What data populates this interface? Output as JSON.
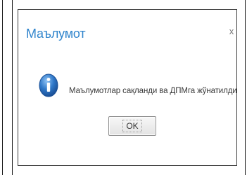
{
  "dialog": {
    "title": "Маълумот",
    "close_glyph": "x",
    "icon": "info-icon",
    "message": "Маълумотлар сақланди ва ДПМга жўнатилди",
    "ok_label": "OK",
    "accent_color": "#2f84cc"
  }
}
